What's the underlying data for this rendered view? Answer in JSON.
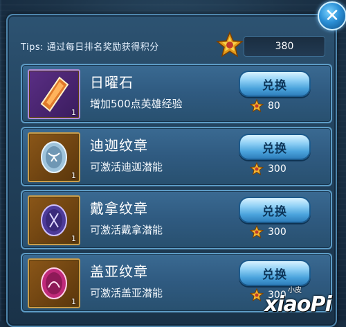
{
  "header": {
    "tips": "Tips: 通过每日排名奖励获得积分",
    "points": "380",
    "points_icon": "star-points-icon",
    "close_icon": "close-icon"
  },
  "items": [
    {
      "name": "日曜石",
      "desc": "增加500点英雄经验",
      "count": "1",
      "button": "兑换",
      "cost": "80",
      "icon": "sun-stone-icon"
    },
    {
      "name": "迪迦纹章",
      "desc": "可激活迪迦潜能",
      "count": "1",
      "button": "兑换",
      "cost": "300",
      "icon": "tiga-emblem-icon"
    },
    {
      "name": "戴拿纹章",
      "desc": "可激活戴拿潜能",
      "count": "1",
      "button": "兑换",
      "cost": "300",
      "icon": "dyna-emblem-icon"
    },
    {
      "name": "盖亚纹章",
      "desc": "可激活盖亚潜能",
      "count": "1",
      "button": "兑换",
      "cost": "300",
      "icon": "gaia-emblem-icon"
    }
  ],
  "watermark": {
    "small": "小皮",
    "main": "xiaoPi"
  },
  "colors": {
    "panel": "#22425d",
    "accent": "#5d9cc6",
    "button": "#4aa3dc",
    "gold": "#f2b632"
  }
}
